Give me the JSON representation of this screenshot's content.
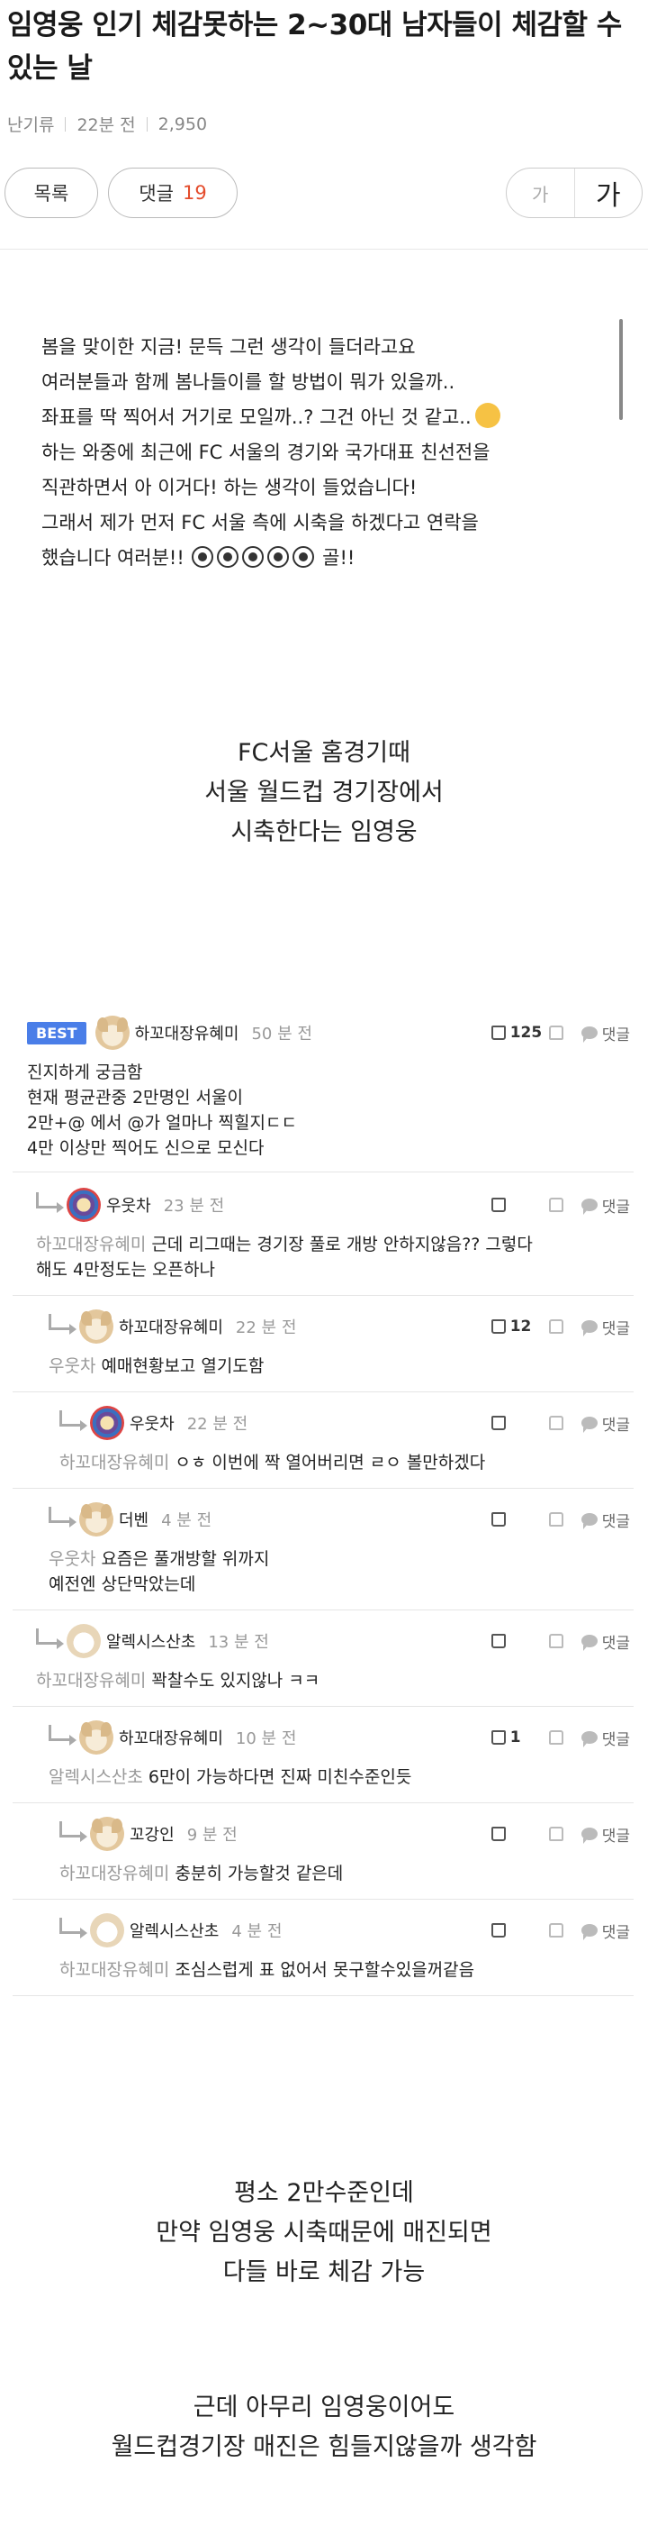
{
  "post": {
    "title": "임영웅 인기 체감못하는 2~30대 남자들이 체감할 수 있는 날",
    "category": "난기류",
    "time": "22분 전",
    "views": "2,950"
  },
  "toolbar": {
    "list_label": "목록",
    "comment_label": "댓글",
    "comment_count": "19",
    "font_small": "가",
    "font_large": "가"
  },
  "body": {
    "intro": [
      "봄을 맞이한 지금! 문득 그런 생각이 들더라고요",
      "여러분들과 함께 봄나들이를 할 방법이 뭐가 있을까..",
      "좌표를 딱 찍어서 거기로 모일까..? 그건 아닌 것 같고..",
      "하는 와중에 최근에 FC 서울의 경기와 국가대표 친선전을",
      "직관하면서 아 이거다! 하는 생각이 들었습니다!",
      "그래서 제가 먼저 FC 서울 측에 시축을 하겠다고 연락을",
      "했습니다 여러분!!",
      "골!!"
    ],
    "caption1": [
      "FC서울 홈경기때",
      "서울 월드컵 경기장에서",
      "시축한다는 임영웅"
    ],
    "caption2": [
      "평소 2만수준인데",
      "만약 임영웅 시축때문에 매진되면",
      "다들 바로 체감 가능"
    ],
    "caption3": [
      "근데 아무리 임영웅이어도",
      "월드컵경기장 매진은 힘들지않을까 생각함"
    ]
  },
  "comments": [
    {
      "best": "BEST",
      "nick": "하꼬대장유혜미",
      "time": "50 분 전",
      "likes": "125",
      "reply": "댓글",
      "lines": [
        "진지하게 궁금함",
        "현재 평균관중 2만명인 서울이",
        "2만+@ 에서 @가 얼마나 찍힐지ㄷㄷ",
        "4만 이상만 찍어도 신으로 모신다"
      ]
    },
    {
      "nick": "우웃차",
      "time": "23 분 전",
      "likes": "",
      "reply": "댓글",
      "to": "하꼬대장유혜미",
      "lines": [
        "근데 리그때는 경기장 풀로 개방 안하지않음?? 그렇다",
        "해도 4만정도는 오픈하나"
      ]
    },
    {
      "nick": "하꼬대장유혜미",
      "time": "22 분 전",
      "likes": "12",
      "reply": "댓글",
      "to": "우웃차",
      "lines": [
        "예매현황보고 열기도함"
      ]
    },
    {
      "nick": "우웃차",
      "time": "22 분 전",
      "likes": "",
      "reply": "댓글",
      "to": "하꼬대장유혜미",
      "lines": [
        "ㅇㅎ 이번에 짝 열어버리면 ㄹㅇ 볼만하겠다"
      ]
    },
    {
      "nick": "더벤",
      "time": "4 분 전",
      "likes": "",
      "reply": "댓글",
      "to": "우웃차",
      "lines": [
        "요즘은 풀개방할 위까지",
        "예전엔 상단막았는데"
      ]
    },
    {
      "nick": "알렉시스산초",
      "time": "13 분 전",
      "likes": "",
      "reply": "댓글",
      "to": "하꼬대장유혜미",
      "lines": [
        "꽉찰수도 있지않나 ㅋㅋ"
      ]
    },
    {
      "nick": "하꼬대장유혜미",
      "time": "10 분 전",
      "likes": "1",
      "reply": "댓글",
      "to": "알렉시스산초",
      "lines": [
        "6만이 가능하다면 진짜 미친수준인듯"
      ]
    },
    {
      "nick": "꼬강인",
      "time": "9 분 전",
      "likes": "",
      "reply": "댓글",
      "to": "하꼬대장유혜미",
      "lines": [
        "충분히 가능할것 같은데"
      ]
    },
    {
      "nick": "알렉시스산초",
      "time": "4 분 전",
      "likes": "",
      "reply": "댓글",
      "to": "하꼬대장유혜미",
      "lines": [
        "조심스럽게 표 없어서 못구할수있을꺼같음"
      ]
    }
  ],
  "colors": {
    "best_badge": "#4a7ee8",
    "comment_count": "#e44c2c"
  },
  "icons": [
    "thumbs-up-icon",
    "thumbs-down-icon",
    "reply-bubble-icon",
    "reply-arrow-icon",
    "soccer-ball-icon",
    "thinking-face-icon"
  ]
}
